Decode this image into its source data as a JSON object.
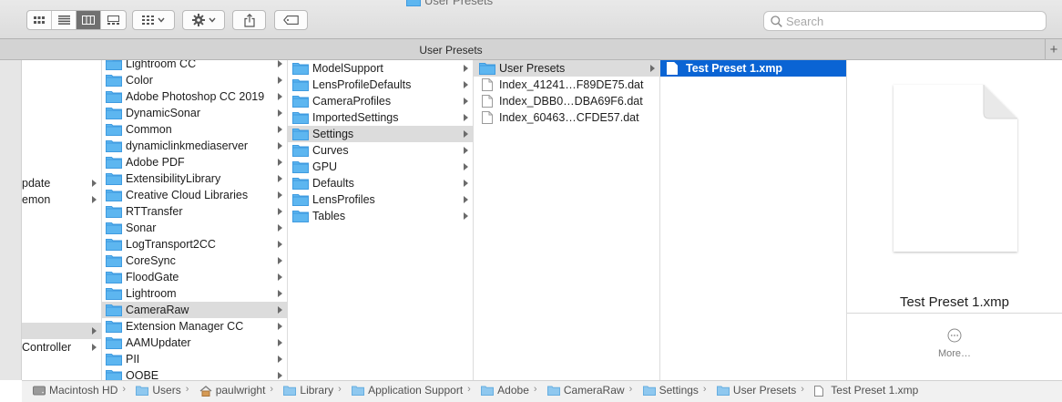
{
  "window": {
    "title": "User Presets"
  },
  "toolbar": {
    "view_modes": [
      "icon-view",
      "list-view",
      "column-view",
      "gallery-view"
    ],
    "active_view": "column-view",
    "group_icon": "grid-icon",
    "action_icon": "gear-icon",
    "share_icon": "share-icon",
    "tag_icon": "tag-icon",
    "search_placeholder": "Search"
  },
  "tab": {
    "title": "User Presets",
    "new_tab_label": "+"
  },
  "column0": {
    "items": [
      {
        "label": "pdate",
        "arrow": true,
        "row": 7
      },
      {
        "label": "emon",
        "arrow": true,
        "row": 8
      },
      {
        "label": "",
        "arrow": true,
        "row": 16,
        "selected": "gray"
      },
      {
        "label": "Controller",
        "arrow": true,
        "row": 17
      }
    ],
    "arrow_rows": [
      0,
      1,
      2,
      3,
      4,
      5,
      6,
      7,
      8,
      9,
      10,
      11,
      12,
      13,
      14,
      15,
      16,
      17,
      18
    ]
  },
  "column1": {
    "items": [
      {
        "label": "Lightroom CC"
      },
      {
        "label": "Color"
      },
      {
        "label": "Adobe Photoshop CC 2019"
      },
      {
        "label": "DynamicSonar"
      },
      {
        "label": "Common"
      },
      {
        "label": "dynamiclinkmediaserver"
      },
      {
        "label": "Adobe PDF"
      },
      {
        "label": "ExtensibilityLibrary"
      },
      {
        "label": "Creative Cloud Libraries"
      },
      {
        "label": "RTTransfer"
      },
      {
        "label": "Sonar"
      },
      {
        "label": "LogTransport2CC"
      },
      {
        "label": "CoreSync"
      },
      {
        "label": "FloodGate"
      },
      {
        "label": "Lightroom"
      },
      {
        "label": "CameraRaw",
        "selected": "gray"
      },
      {
        "label": "Extension Manager CC"
      },
      {
        "label": "AAMUpdater"
      },
      {
        "label": "PII"
      },
      {
        "label": "OOBE"
      }
    ]
  },
  "column2": {
    "items": [
      {
        "label": "ModelSupport"
      },
      {
        "label": "LensProfileDefaults"
      },
      {
        "label": "CameraProfiles"
      },
      {
        "label": "ImportedSettings"
      },
      {
        "label": "Settings",
        "selected": "gray"
      },
      {
        "label": "Curves"
      },
      {
        "label": "GPU"
      },
      {
        "label": "Defaults"
      },
      {
        "label": "LensProfiles"
      },
      {
        "label": "Tables"
      }
    ]
  },
  "column3": {
    "items": [
      {
        "label": "User Presets",
        "type": "folder",
        "selected": "gray"
      },
      {
        "label": "Index_41241…F89DE75.dat",
        "type": "file"
      },
      {
        "label": "Index_DBB0…DBA69F6.dat",
        "type": "file"
      },
      {
        "label": "Index_60463…CFDE57.dat",
        "type": "file"
      }
    ]
  },
  "column4": {
    "items": [
      {
        "label": "Test Preset 1.xmp",
        "type": "file",
        "selected": "blue"
      }
    ]
  },
  "preview": {
    "file_name": "Test Preset 1.xmp",
    "more_label": "More…"
  },
  "pathbar": {
    "crumbs": [
      {
        "label": "Macintosh HD",
        "icon": "hard-drive-icon"
      },
      {
        "label": "Users",
        "icon": "folder-icon"
      },
      {
        "label": "paulwright",
        "icon": "home-icon"
      },
      {
        "label": "Library",
        "icon": "folder-icon"
      },
      {
        "label": "Application Support",
        "icon": "folder-icon"
      },
      {
        "label": "Adobe",
        "icon": "folder-icon"
      },
      {
        "label": "CameraRaw",
        "icon": "folder-icon"
      },
      {
        "label": "Settings",
        "icon": "folder-icon"
      },
      {
        "label": "User Presets",
        "icon": "folder-icon"
      },
      {
        "label": "Test Preset 1.xmp",
        "icon": "document-icon"
      }
    ],
    "separator": "›"
  },
  "colors": {
    "folder": "#5db6f0",
    "folder_dark": "#3f9be0",
    "selection_blue": "#0a64d4",
    "selection_gray": "#dcdcdc"
  }
}
